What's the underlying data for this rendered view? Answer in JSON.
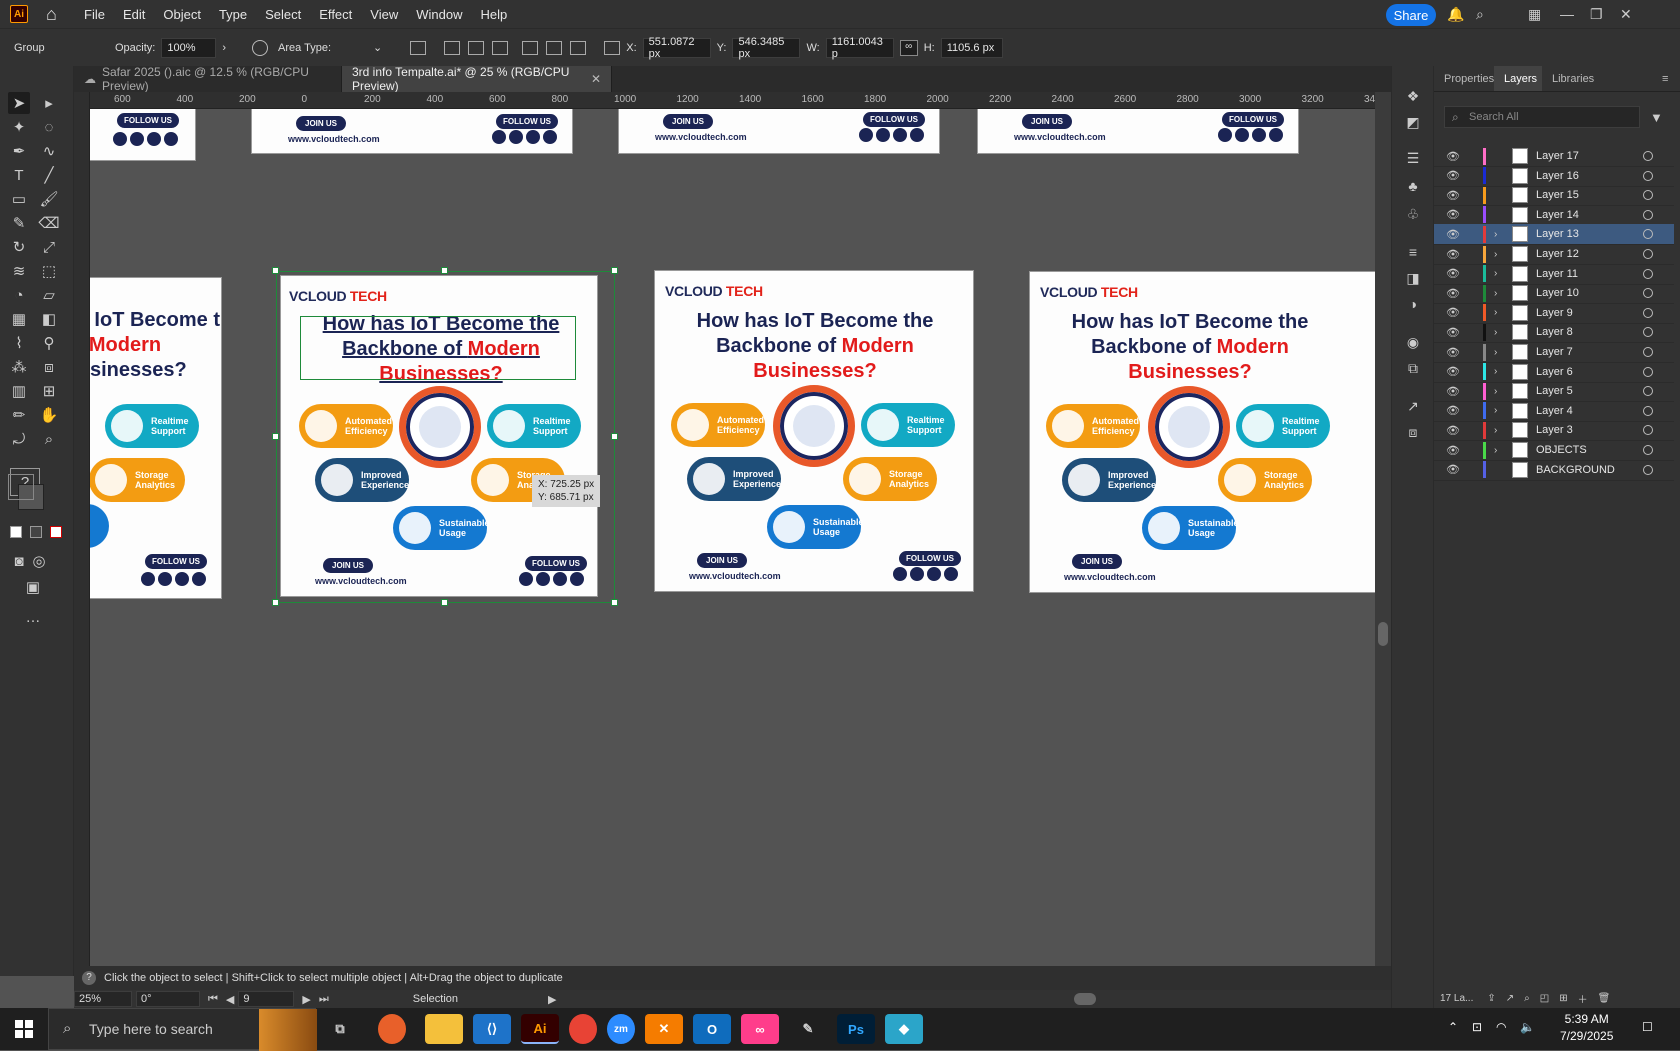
{
  "app": {
    "logo": "Ai"
  },
  "menus": [
    "File",
    "Edit",
    "Object",
    "Type",
    "Select",
    "Effect",
    "View",
    "Window",
    "Help"
  ],
  "share_label": "Share",
  "control": {
    "selection_type": "Group",
    "opacity_label": "Opacity:",
    "opacity": "100%",
    "area_type_label": "Area Type:",
    "x_label": "X:",
    "x": "551.0872 px",
    "y_label": "Y:",
    "y": "546.3485 px",
    "w_label": "W:",
    "w": "1161.0043 p",
    "h_label": "H:",
    "h": "1105.6 px"
  },
  "tabs": [
    {
      "label": "Safar 2025 ().aic @ 12.5 % (RGB/CPU Preview)"
    },
    {
      "label": "3rd info Tempalte.ai* @ 25 % (RGB/CPU Preview)"
    }
  ],
  "ruler_ticks": [
    "600",
    "400",
    "200",
    "0",
    "200",
    "400",
    "600",
    "800",
    "1000",
    "1200",
    "1400",
    "1600",
    "1800",
    "2000",
    "2200",
    "2400",
    "2600",
    "2800",
    "3000",
    "3200",
    "34"
  ],
  "artboard": {
    "logo_a": "VCLOUD",
    "logo_b": "TECH",
    "title_line1": "How has IoT Become the",
    "title_line2a": "Backbone of ",
    "title_line2b": "Modern",
    "title_line3": "Businesses?",
    "pill_auto1": "Automated",
    "pill_auto2": "Efficiency",
    "pill_real1": "Realtime",
    "pill_real2": "Support",
    "pill_improved1": "Improved",
    "pill_improved2": "Experience",
    "pill_storage1": "Storage",
    "pill_storage2": "Analytics",
    "pill_sustain1": "Sustainable",
    "pill_sustain2": "Usage",
    "join": "JOIN US",
    "follow": "FOLLOW US",
    "site": "www.vcloudtech.com"
  },
  "tooltip": {
    "x": "X: 725.25 px",
    "y": "Y: 685.71 px"
  },
  "hint": "Click the object to select  |  Shift+Click to select multiple object  |  Alt+Drag the object to duplicate",
  "status": {
    "zoom": "25%",
    "rotation": "0°",
    "artboard": "9",
    "tool": "Selection"
  },
  "panel_tabs": [
    "Properties",
    "Layers",
    "Libraries"
  ],
  "layers_search_placeholder": "Search All",
  "layers": [
    {
      "name": "Layer 17",
      "color": "#ff6ec7",
      "expand": false
    },
    {
      "name": "Layer 16",
      "color": "#1a2bd6",
      "expand": false
    },
    {
      "name": "Layer 15",
      "color": "#f79c1c",
      "expand": false
    },
    {
      "name": "Layer 14",
      "color": "#9b4dff",
      "expand": false
    },
    {
      "name": "Layer 13",
      "color": "#e23b3b",
      "expand": true,
      "active": true
    },
    {
      "name": "Layer 12",
      "color": "#f7a63c",
      "expand": true
    },
    {
      "name": "Layer 11",
      "color": "#1bbc9b",
      "expand": true
    },
    {
      "name": "Layer 10",
      "color": "#1e8a3a",
      "expand": true
    },
    {
      "name": "Layer 9",
      "color": "#f05a28",
      "expand": true
    },
    {
      "name": "Layer 8",
      "color": "#111111",
      "expand": true
    },
    {
      "name": "Layer 7",
      "color": "#888888",
      "expand": true
    },
    {
      "name": "Layer 6",
      "color": "#2ee6e6",
      "expand": true
    },
    {
      "name": "Layer 5",
      "color": "#ff5fd2",
      "expand": true
    },
    {
      "name": "Layer 4",
      "color": "#3f6cf0",
      "expand": true
    },
    {
      "name": "Layer 3",
      "color": "#e03a3a",
      "expand": true
    },
    {
      "name": "OBJECTS",
      "color": "#4ad94a",
      "expand": true
    },
    {
      "name": "BACKGROUND",
      "color": "#5561e6",
      "expand": false
    }
  ],
  "layers_count": "17 La...",
  "taskbar": {
    "search_placeholder": "Type here to search",
    "time": "5:39 AM",
    "date": "7/29/2025"
  }
}
